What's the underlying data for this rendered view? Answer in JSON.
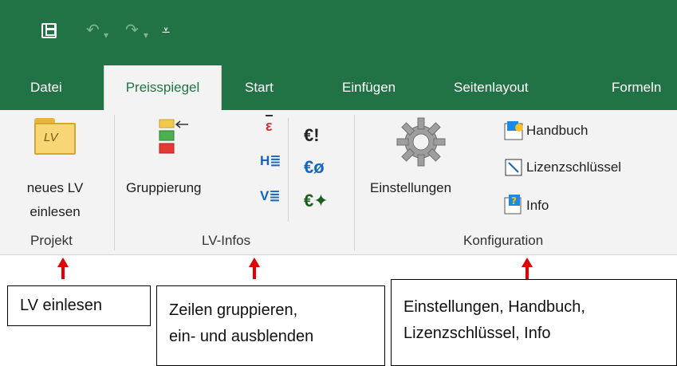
{
  "quick_access": {
    "save_icon": "save-icon",
    "undo_icon": "undo-icon",
    "redo_icon": "redo-icon",
    "customize_icon": "customize-icon",
    "undo_glyph": "↶",
    "redo_glyph": "↷",
    "dropdown_glyph": "▾",
    "customize_glyph": "⩡"
  },
  "tabs": [
    {
      "label": "Datei",
      "active": false
    },
    {
      "label": "Preisspiegel",
      "active": true
    },
    {
      "label": "Start",
      "active": false
    },
    {
      "label": "Einfügen",
      "active": false
    },
    {
      "label": "Seitenlayout",
      "active": false
    },
    {
      "label": "Formeln",
      "active": false
    }
  ],
  "ribbon": {
    "projekt": {
      "button_line1": "neues LV",
      "button_line2": "einlesen",
      "icon_text": "LV",
      "group_label": "Projekt"
    },
    "lvinfos": {
      "grouping_label": "Gruppierung",
      "group_label": "LV-Infos",
      "glyph_e_red": "ε",
      "glyph_h": "H≣",
      "glyph_v": "V≣",
      "glyph_euro_excl": "€!",
      "glyph_euro_avg": "€ø",
      "glyph_euro_star": "€✦"
    },
    "konfiguration": {
      "settings_label": "Einstellungen",
      "handbuch_label": "Handbuch",
      "lizenz_label": "Lizenzschlüssel",
      "info_label": "Info",
      "group_label": "Konfiguration"
    }
  },
  "callouts": {
    "lv": "LV einlesen",
    "zeilen_line1": "Zeilen gruppieren,",
    "zeilen_line2": "ein- und ausblenden",
    "konfig_line1": "Einstellungen, Handbuch,",
    "konfig_line2": "Lizenzschlüssel, Info"
  },
  "colors": {
    "excel_green": "#217346",
    "ribbon_bg": "#f3f3f3",
    "arrow_red": "#e00000"
  }
}
